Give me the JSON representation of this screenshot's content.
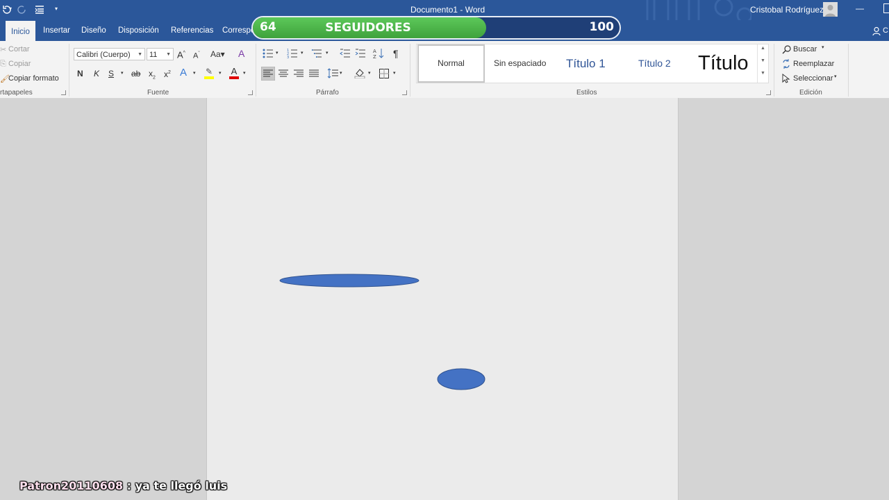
{
  "titlebar": {
    "doc_title": "Documento1  -  Word",
    "user_name": "Cristobal Rodríguez",
    "minimize": "—"
  },
  "tabs": [
    "Inicio",
    "Insertar",
    "Diseño",
    "Disposición",
    "Referencias",
    "Correspo"
  ],
  "share_partial": "C",
  "clipboard": {
    "cut": "Cortar",
    "copy": "Copiar",
    "format_painter": "Copiar formato",
    "group_label": "rtapapeles"
  },
  "font": {
    "family": "Calibri (Cuerpo)",
    "size": "11",
    "bold": "N",
    "italic": "K",
    "underline": "S",
    "strike": "ab",
    "group_label": "Fuente"
  },
  "paragraph": {
    "group_label": "Párrafo"
  },
  "styles": {
    "items": [
      "Normal",
      "Sin espaciado",
      "Título 1",
      "Título 2",
      "Título"
    ],
    "group_label": "Estilos"
  },
  "editing": {
    "find": "Buscar",
    "replace": "Reemplazar",
    "select": "Seleccionar",
    "group_label": "Edición"
  },
  "followers": {
    "current": "64",
    "label": "SEGUIDORES",
    "goal": "100",
    "progress": 0.64
  },
  "chat": {
    "user": "Patron20110608",
    "message": " : ya te llegó luis"
  },
  "colors": {
    "brand_blue": "#2b579a",
    "shape_fill": "#4472c4",
    "progress_green": "#4cb849"
  }
}
